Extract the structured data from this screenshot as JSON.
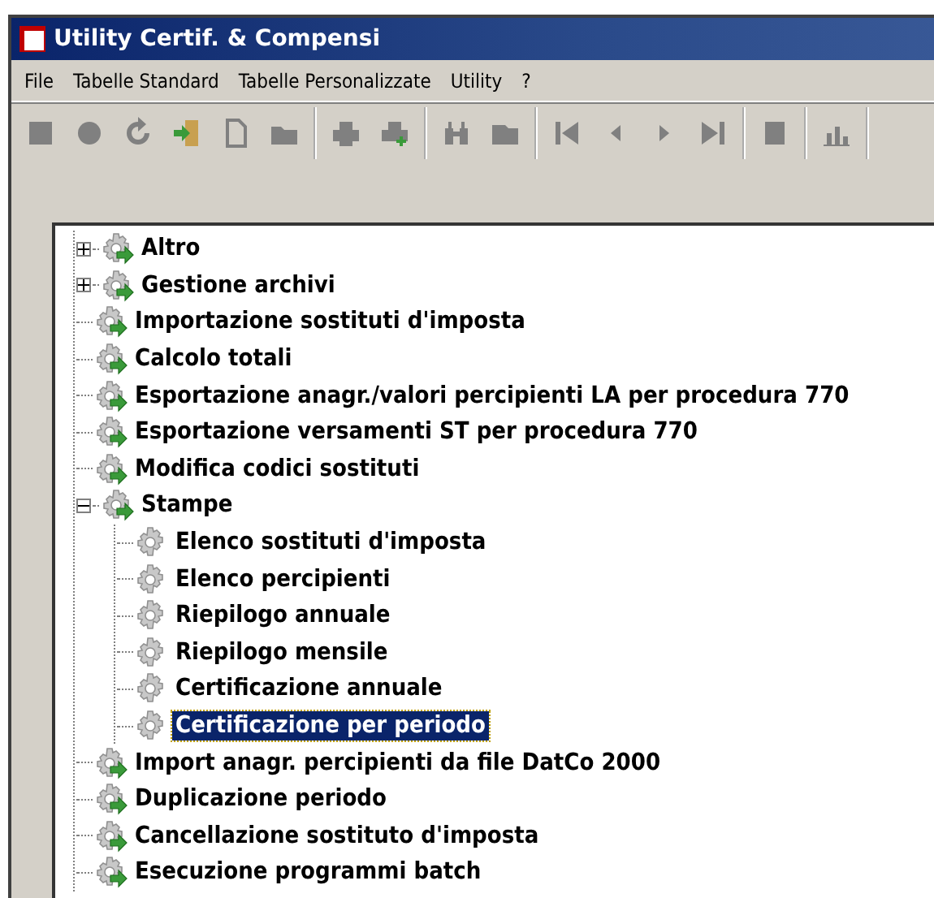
{
  "window": {
    "title": "Utility Certif. & Compensi"
  },
  "menu": [
    "File",
    "Tabelle Standard",
    "Tabelle Personalizzate",
    "Utility",
    "?"
  ],
  "tree": [
    {
      "label": "Altro",
      "kind": "task",
      "expandable": true,
      "expanded": false,
      "selected": false
    },
    {
      "label": "Gestione archivi",
      "kind": "task",
      "expandable": true,
      "expanded": false,
      "selected": false
    },
    {
      "label": "Importazione sostituti d'imposta",
      "kind": "task",
      "expandable": false,
      "expanded": false,
      "selected": false
    },
    {
      "label": "Calcolo totali",
      "kind": "task",
      "expandable": false,
      "expanded": false,
      "selected": false
    },
    {
      "label": "Esportazione anagr./valori percipienti LA per procedura 770",
      "kind": "task",
      "expandable": false,
      "expanded": false,
      "selected": false
    },
    {
      "label": "Esportazione versamenti ST per procedura 770",
      "kind": "task",
      "expandable": false,
      "expanded": false,
      "selected": false
    },
    {
      "label": "Modifica codici sostituti",
      "kind": "task",
      "expandable": false,
      "expanded": false,
      "selected": false
    },
    {
      "label": "Stampe",
      "kind": "task",
      "expandable": true,
      "expanded": true,
      "selected": false,
      "children": [
        {
          "label": "Elenco sostituti d'imposta",
          "kind": "report",
          "expandable": false,
          "expanded": false,
          "selected": false
        },
        {
          "label": "Elenco percipienti",
          "kind": "report",
          "expandable": false,
          "expanded": false,
          "selected": false
        },
        {
          "label": "Riepilogo annuale",
          "kind": "report",
          "expandable": false,
          "expanded": false,
          "selected": false
        },
        {
          "label": "Riepilogo mensile",
          "kind": "report",
          "expandable": false,
          "expanded": false,
          "selected": false
        },
        {
          "label": "Certificazione annuale",
          "kind": "report",
          "expandable": false,
          "expanded": false,
          "selected": false
        },
        {
          "label": "Certificazione per periodo",
          "kind": "report",
          "expandable": false,
          "expanded": false,
          "selected": true
        }
      ]
    },
    {
      "label": "Import anagr. percipienti da file DatCo 2000",
      "kind": "task",
      "expandable": false,
      "expanded": false,
      "selected": false
    },
    {
      "label": "Duplicazione periodo",
      "kind": "task",
      "expandable": false,
      "expanded": false,
      "selected": false
    },
    {
      "label": "Cancellazione sostituto d'imposta",
      "kind": "task",
      "expandable": false,
      "expanded": false,
      "selected": false
    },
    {
      "label": "Esecuzione programmi batch",
      "kind": "task",
      "expandable": false,
      "expanded": false,
      "selected": false
    }
  ]
}
